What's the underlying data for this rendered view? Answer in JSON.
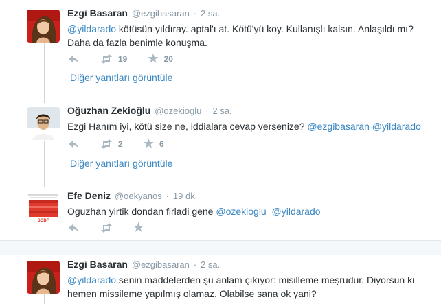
{
  "tweets": [
    {
      "fullname": "Ezgi Basaran",
      "username": "@ezgibasaran",
      "time": "2 sa.",
      "parts": [
        {
          "t": "@yildarado",
          "m": true
        },
        {
          "t": " kötüsün yıldıray. aptal'ı at. Kötü'yü koy. Kullanışlı kalsın. Anlaşıldı mı? Daha da fazla benimle konuşma.",
          "m": false
        }
      ],
      "retweets": "19",
      "favorites": "20"
    },
    {
      "fullname": "Oğuzhan Zekioğlu",
      "username": "@ozekioglu",
      "time": "2 sa.",
      "parts": [
        {
          "t": "Ezgi Hanım iyi, kötü size ne, iddialara cevap versenize? ",
          "m": false
        },
        {
          "t": "@ezgibasaran",
          "m": true
        },
        {
          "t": " ",
          "m": false
        },
        {
          "t": "@yildarado",
          "m": true
        }
      ],
      "retweets": "2",
      "favorites": "6"
    },
    {
      "fullname": "Efe Deniz",
      "username": "@oekyanos",
      "time": "19 dk.",
      "parts": [
        {
          "t": "Oguzhan yirtik dondan firladi gene ",
          "m": false
        },
        {
          "t": "@ozekioglu",
          "m": true
        },
        {
          "t": "  ",
          "m": false
        },
        {
          "t": "@yildarado",
          "m": true
        }
      ],
      "retweets": "",
      "favorites": ""
    },
    {
      "fullname": "Ezgi Basaran",
      "username": "@ezgibasaran",
      "time": "2 sa.",
      "parts": [
        {
          "t": "@yildarado",
          "m": true
        },
        {
          "t": " senin maddelerden şu anlam çıkıyor: misilleme meşrudur. Diyorsun ki hemen missileme yapılmış olamaz. Olabilse sana ok yani?",
          "m": false
        }
      ],
      "retweets": "",
      "favorites": ""
    }
  ],
  "more_replies_label": "Diğer yanıtları görüntüle",
  "avatar3_badge": "SGDF",
  "colors": {
    "link": "#3b88c3",
    "muted": "#8899a6",
    "icon": "#aab8c2",
    "conversation_line": "#ccd6dd"
  },
  "icons": [
    "reply-icon",
    "retweet-icon",
    "favorite-star-icon"
  ]
}
